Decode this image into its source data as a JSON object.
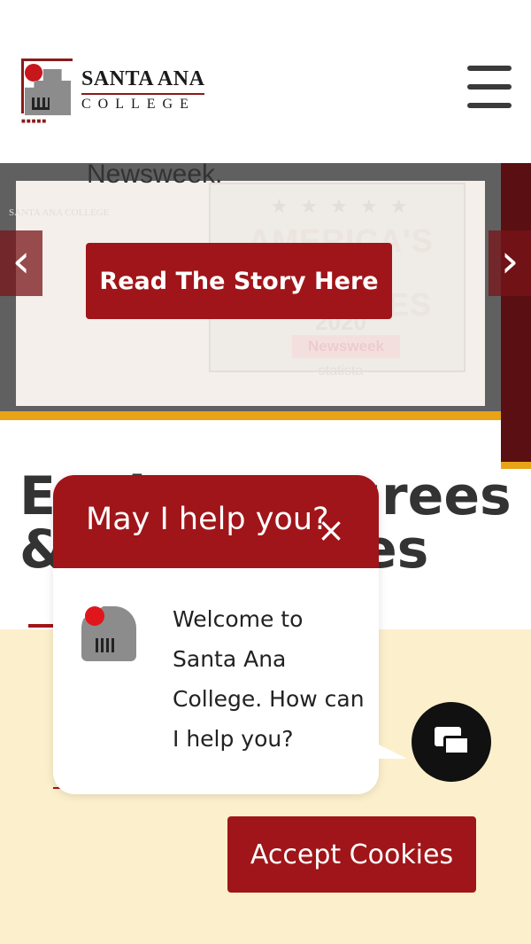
{
  "header": {
    "logo_line1": "SANTA ANA",
    "logo_line2": "COLLEGE"
  },
  "hero": {
    "text": "Newsweek.",
    "cta_label": "Read The Story Here",
    "prev_label": "‹",
    "next_label": "›",
    "background": {
      "brand": "SANTA ANA COLLEGE",
      "stars": "★ ★ ★ ★ ★",
      "title": "AMERICA'S TOP COLLEGES",
      "year": "2020",
      "publisher": "Newsweek",
      "partner": "statista"
    }
  },
  "section": {
    "heading": "Explore Degrees & Certificates"
  },
  "chat": {
    "title": "May I help you?",
    "close_label": "×",
    "message": "Welcome to Santa Ana College. How can I help you?"
  },
  "cookie": {
    "accept_label": "Accept Cookies"
  },
  "colors": {
    "brand_red": "#a01519",
    "gold": "#e8a317",
    "cookie_bg": "#fcf0cc"
  }
}
